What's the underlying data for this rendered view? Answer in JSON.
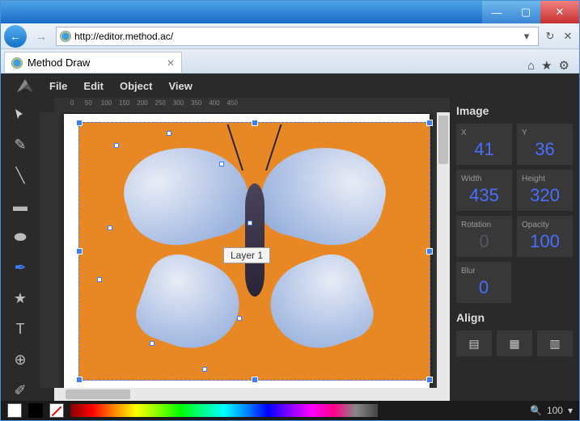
{
  "browser": {
    "url": "http://editor.method.ac/",
    "tab_title": "Method Draw"
  },
  "menu": {
    "file": "File",
    "edit": "Edit",
    "object": "Object",
    "view": "View"
  },
  "layer_label": "Layer 1",
  "panel": {
    "heading": "Image",
    "x": {
      "label": "X",
      "value": "41"
    },
    "y": {
      "label": "Y",
      "value": "36"
    },
    "width": {
      "label": "Width",
      "value": "435"
    },
    "height": {
      "label": "Height",
      "value": "320"
    },
    "rotation": {
      "label": "Rotation",
      "value": "0"
    },
    "opacity": {
      "label": "Opacity",
      "value": "100"
    },
    "blur": {
      "label": "Blur",
      "value": "0"
    },
    "align_heading": "Align"
  },
  "zoom": {
    "value": "100"
  }
}
